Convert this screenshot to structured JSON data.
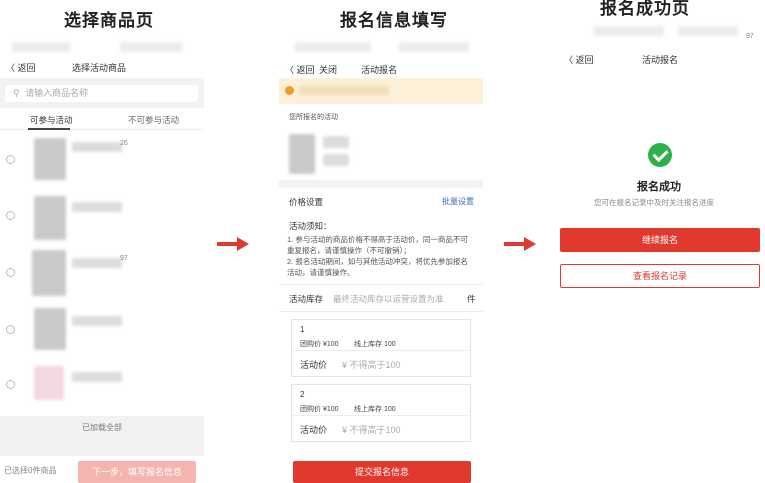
{
  "titles": [
    "选择商品页",
    "报名信息填写",
    "报名成功页"
  ],
  "screen1": {
    "nav": {
      "back": "〈 返回",
      "title": "选择活动商品"
    },
    "search_placeholder": "请输入商品名称",
    "search_icon": "search-icon",
    "tabs": [
      "可参与活动",
      "不可参与活动"
    ],
    "visible_fragments": [
      "26",
      "97"
    ],
    "loaded_all": "已加载全部",
    "selected_count": "已选择0件商品",
    "next_button": "下一步，填写报名信息"
  },
  "screen2": {
    "nav": {
      "back": "〈 返回",
      "close": "关闭",
      "title": "活动报名"
    },
    "signup_label": "您所报名的活动",
    "price_setting": "价格设置",
    "batch_setting": "批量设置",
    "rules_title": "活动须知：",
    "rules": [
      "1. 参与活动的商品价格不得高于活动价，同一商品不可重复报名，请谨慎操作（不可撤销）；",
      "2. 报名活动期间，如与其他活动冲突，将优先参加报名活动，请谨慎操作。"
    ],
    "stock_label": "活动库存",
    "stock_placeholder": "最终活动库存以运营设置为准",
    "stock_unit": "件",
    "items": [
      {
        "index": "1",
        "group_price": "团购价 ¥100",
        "online_stock": "线上库存 100",
        "price_label": "活动价",
        "price_placeholder": "¥ 不得高于100"
      },
      {
        "index": "2",
        "group_price": "团购价 ¥100",
        "online_stock": "线上库存 100",
        "price_label": "活动价",
        "price_placeholder": "¥ 不得高于100"
      }
    ],
    "submit_button": "提交报名信息"
  },
  "screen3": {
    "status_fragment": "97",
    "nav": {
      "back": "〈 返回",
      "title": "活动报名"
    },
    "success_title": "报名成功",
    "success_sub": "您可在报名记录中及时关注报名进度",
    "continue_button": "继续报名",
    "records_button": "查看报名记录"
  },
  "colors": {
    "accent": "#e03a2f",
    "success": "#2bb24c",
    "banner": "#fdf0d8",
    "disabled": "#f4b5b0",
    "link": "#3a6fc4"
  }
}
